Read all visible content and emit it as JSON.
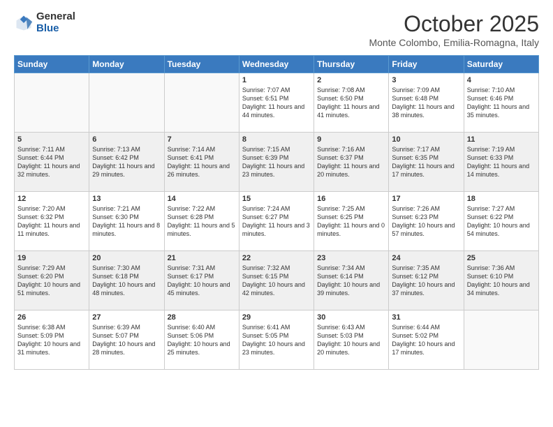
{
  "logo": {
    "general": "General",
    "blue": "Blue"
  },
  "header": {
    "month": "October 2025",
    "location": "Monte Colombo, Emilia-Romagna, Italy"
  },
  "weekdays": [
    "Sunday",
    "Monday",
    "Tuesday",
    "Wednesday",
    "Thursday",
    "Friday",
    "Saturday"
  ],
  "weeks": [
    [
      {
        "day": "",
        "info": ""
      },
      {
        "day": "",
        "info": ""
      },
      {
        "day": "",
        "info": ""
      },
      {
        "day": "1",
        "info": "Sunrise: 7:07 AM\nSunset: 6:51 PM\nDaylight: 11 hours and 44 minutes."
      },
      {
        "day": "2",
        "info": "Sunrise: 7:08 AM\nSunset: 6:50 PM\nDaylight: 11 hours and 41 minutes."
      },
      {
        "day": "3",
        "info": "Sunrise: 7:09 AM\nSunset: 6:48 PM\nDaylight: 11 hours and 38 minutes."
      },
      {
        "day": "4",
        "info": "Sunrise: 7:10 AM\nSunset: 6:46 PM\nDaylight: 11 hours and 35 minutes."
      }
    ],
    [
      {
        "day": "5",
        "info": "Sunrise: 7:11 AM\nSunset: 6:44 PM\nDaylight: 11 hours and 32 minutes."
      },
      {
        "day": "6",
        "info": "Sunrise: 7:13 AM\nSunset: 6:42 PM\nDaylight: 11 hours and 29 minutes."
      },
      {
        "day": "7",
        "info": "Sunrise: 7:14 AM\nSunset: 6:41 PM\nDaylight: 11 hours and 26 minutes."
      },
      {
        "day": "8",
        "info": "Sunrise: 7:15 AM\nSunset: 6:39 PM\nDaylight: 11 hours and 23 minutes."
      },
      {
        "day": "9",
        "info": "Sunrise: 7:16 AM\nSunset: 6:37 PM\nDaylight: 11 hours and 20 minutes."
      },
      {
        "day": "10",
        "info": "Sunrise: 7:17 AM\nSunset: 6:35 PM\nDaylight: 11 hours and 17 minutes."
      },
      {
        "day": "11",
        "info": "Sunrise: 7:19 AM\nSunset: 6:33 PM\nDaylight: 11 hours and 14 minutes."
      }
    ],
    [
      {
        "day": "12",
        "info": "Sunrise: 7:20 AM\nSunset: 6:32 PM\nDaylight: 11 hours and 11 minutes."
      },
      {
        "day": "13",
        "info": "Sunrise: 7:21 AM\nSunset: 6:30 PM\nDaylight: 11 hours and 8 minutes."
      },
      {
        "day": "14",
        "info": "Sunrise: 7:22 AM\nSunset: 6:28 PM\nDaylight: 11 hours and 5 minutes."
      },
      {
        "day": "15",
        "info": "Sunrise: 7:24 AM\nSunset: 6:27 PM\nDaylight: 11 hours and 3 minutes."
      },
      {
        "day": "16",
        "info": "Sunrise: 7:25 AM\nSunset: 6:25 PM\nDaylight: 11 hours and 0 minutes."
      },
      {
        "day": "17",
        "info": "Sunrise: 7:26 AM\nSunset: 6:23 PM\nDaylight: 10 hours and 57 minutes."
      },
      {
        "day": "18",
        "info": "Sunrise: 7:27 AM\nSunset: 6:22 PM\nDaylight: 10 hours and 54 minutes."
      }
    ],
    [
      {
        "day": "19",
        "info": "Sunrise: 7:29 AM\nSunset: 6:20 PM\nDaylight: 10 hours and 51 minutes."
      },
      {
        "day": "20",
        "info": "Sunrise: 7:30 AM\nSunset: 6:18 PM\nDaylight: 10 hours and 48 minutes."
      },
      {
        "day": "21",
        "info": "Sunrise: 7:31 AM\nSunset: 6:17 PM\nDaylight: 10 hours and 45 minutes."
      },
      {
        "day": "22",
        "info": "Sunrise: 7:32 AM\nSunset: 6:15 PM\nDaylight: 10 hours and 42 minutes."
      },
      {
        "day": "23",
        "info": "Sunrise: 7:34 AM\nSunset: 6:14 PM\nDaylight: 10 hours and 39 minutes."
      },
      {
        "day": "24",
        "info": "Sunrise: 7:35 AM\nSunset: 6:12 PM\nDaylight: 10 hours and 37 minutes."
      },
      {
        "day": "25",
        "info": "Sunrise: 7:36 AM\nSunset: 6:10 PM\nDaylight: 10 hours and 34 minutes."
      }
    ],
    [
      {
        "day": "26",
        "info": "Sunrise: 6:38 AM\nSunset: 5:09 PM\nDaylight: 10 hours and 31 minutes."
      },
      {
        "day": "27",
        "info": "Sunrise: 6:39 AM\nSunset: 5:07 PM\nDaylight: 10 hours and 28 minutes."
      },
      {
        "day": "28",
        "info": "Sunrise: 6:40 AM\nSunset: 5:06 PM\nDaylight: 10 hours and 25 minutes."
      },
      {
        "day": "29",
        "info": "Sunrise: 6:41 AM\nSunset: 5:05 PM\nDaylight: 10 hours and 23 minutes."
      },
      {
        "day": "30",
        "info": "Sunrise: 6:43 AM\nSunset: 5:03 PM\nDaylight: 10 hours and 20 minutes."
      },
      {
        "day": "31",
        "info": "Sunrise: 6:44 AM\nSunset: 5:02 PM\nDaylight: 10 hours and 17 minutes."
      },
      {
        "day": "",
        "info": ""
      }
    ]
  ]
}
